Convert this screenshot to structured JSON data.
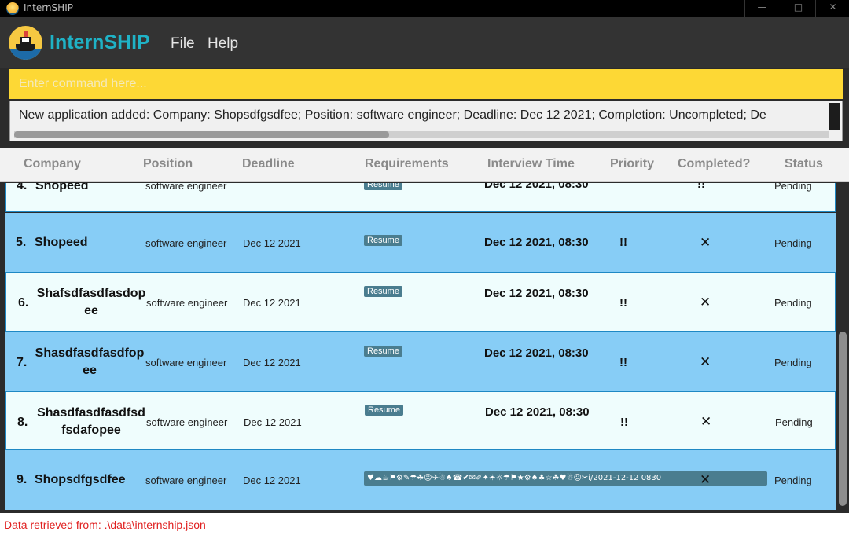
{
  "window": {
    "title": "InternSHIP",
    "minimize": "—",
    "maximize": "□",
    "close": "✕"
  },
  "topbar": {
    "app_name": "InternSHIP",
    "menu": {
      "file": "File",
      "help": "Help"
    },
    "logo_icon": "ship-logo-icon"
  },
  "command": {
    "value": "",
    "placeholder": "Enter command here..."
  },
  "result": {
    "text": "New application added: Company: Shopsdfgsdfee; Position: software engineer; Deadline: Dec 12 2021; Completion: Uncompleted; De"
  },
  "table": {
    "headers": [
      "Company",
      "Position",
      "Deadline",
      "Requirements",
      "Interview Time",
      "Priority",
      "Completed?",
      "Status"
    ],
    "partial_row": {
      "index": "4.",
      "company": "Shopeed",
      "position": "software engineer",
      "tag": "Resume",
      "time": "Dec 12 2021, 08:30",
      "priority": "!!",
      "status": "Pending"
    },
    "rows": [
      {
        "index": "5.",
        "company_lines": [
          "Shopeed"
        ],
        "position": "software engineer",
        "deadline": "Dec 12 2021",
        "requirements": [
          "Resume"
        ],
        "interview_time": "Dec 12 2021, 08:30",
        "priority": "!!",
        "completed": "✕",
        "status": "Pending"
      },
      {
        "index": "6.",
        "company_lines": [
          "Shafsdfasdfasdop",
          "ee"
        ],
        "position": "software engineer",
        "deadline": "Dec 12 2021",
        "requirements": [
          "Resume"
        ],
        "interview_time": "Dec 12 2021, 08:30",
        "priority": "!!",
        "completed": "✕",
        "status": "Pending"
      },
      {
        "index": "7.",
        "company_lines": [
          "Shasdfasdfasdfop",
          "ee"
        ],
        "position": "software engineer",
        "deadline": "Dec 12 2021",
        "requirements": [
          "Resume"
        ],
        "interview_time": "Dec 12 2021, 08:30",
        "priority": "!!",
        "completed": "✕",
        "status": "Pending"
      },
      {
        "index": "8.",
        "company_lines": [
          "Shasdfasdfasdfsd",
          "fsdafopee"
        ],
        "position": "software engineer",
        "deadline": "Dec 12 2021",
        "requirements": [
          "Resume"
        ],
        "interview_time": "Dec 12 2021, 08:30",
        "priority": "!!",
        "completed": "✕",
        "status": "Pending"
      },
      {
        "index": "9.",
        "company_lines": [
          "Shopsdfgsdfee"
        ],
        "position": "software engineer",
        "deadline": "Dec 12 2021",
        "requirements_strip": "♥☁☕⚑⚙✎☂☘☺✈☃♠☎✔✉✐✦☀☼☂⚑★⚙♠♣☆☘♥☃☺✂i/2021-12-12 0830",
        "interview_time": "",
        "priority": "",
        "completed": "✕",
        "status": "Pending"
      }
    ]
  },
  "statusbar": {
    "text": "Data retrieved from:  .\\data\\internship.json"
  },
  "colors": {
    "accent": "#1fb2c6",
    "command_bg": "#fdd835",
    "row_blue": "#87cdf6",
    "row_light": "#effdfd",
    "tag_bg": "#4a7d8f",
    "status_text": "#e02020"
  }
}
